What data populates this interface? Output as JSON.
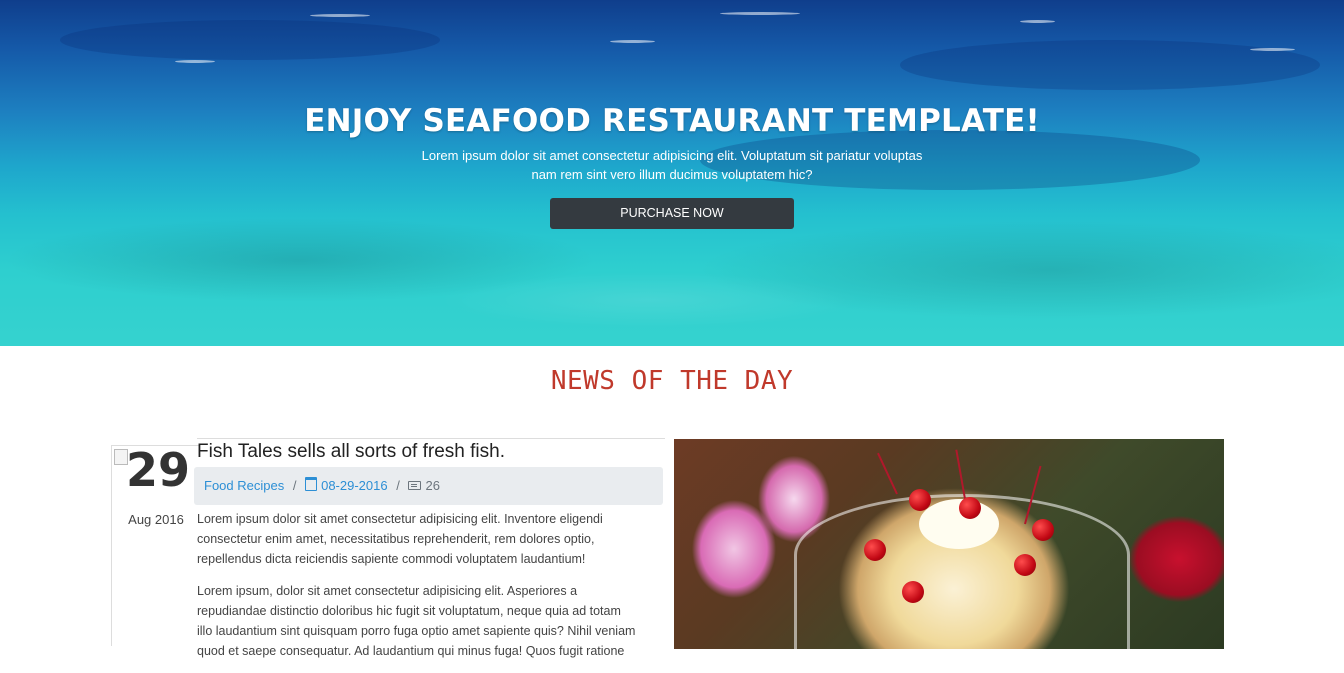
{
  "hero": {
    "title": "ENJOY SEAFOOD RESTAURANT TEMPLATE!",
    "subtitle": "Lorem ipsum dolor sit amet consectetur adipisicing elit. Voluptatum sit pariatur voluptas nam rem sint vero illum ducimus voluptatem hic?",
    "button_label": "PURCHASE NOW"
  },
  "news": {
    "heading": "NEWS OF THE DAY",
    "article": {
      "day": "29",
      "month_year": "Aug 2016",
      "title": "Fish Tales sells all sorts of fresh fish.",
      "category": "Food Recipes",
      "date": "08-29-2016",
      "comments": "26",
      "paragraphs": [
        "Lorem ipsum dolor sit amet consectetur adipisicing elit. Inventore eligendi consectetur enim amet, necessitatibus reprehenderit, rem dolores optio, repellendus dicta reiciendis sapiente commodi voluptatem laudantium!",
        "Lorem ipsum, dolor sit amet consectetur adipisicing elit. Asperiores a repudiandae distinctio doloribus hic fugit sit voluptatum, neque quia ad totam illo laudantium sint quisquam porro fuga optio amet sapiente quis? Nihil veniam quod et saepe consequatur. Ad laudantium qui minus fuga! Quos fugit ratione"
      ]
    }
  },
  "colors": {
    "heading_red": "#c0392b",
    "link_blue": "#2d8fd5",
    "button_dark": "#343a40",
    "meta_bg": "#e9ecef"
  },
  "icons": {
    "calendar": "calendar-icon",
    "comments": "newspaper-icon"
  }
}
